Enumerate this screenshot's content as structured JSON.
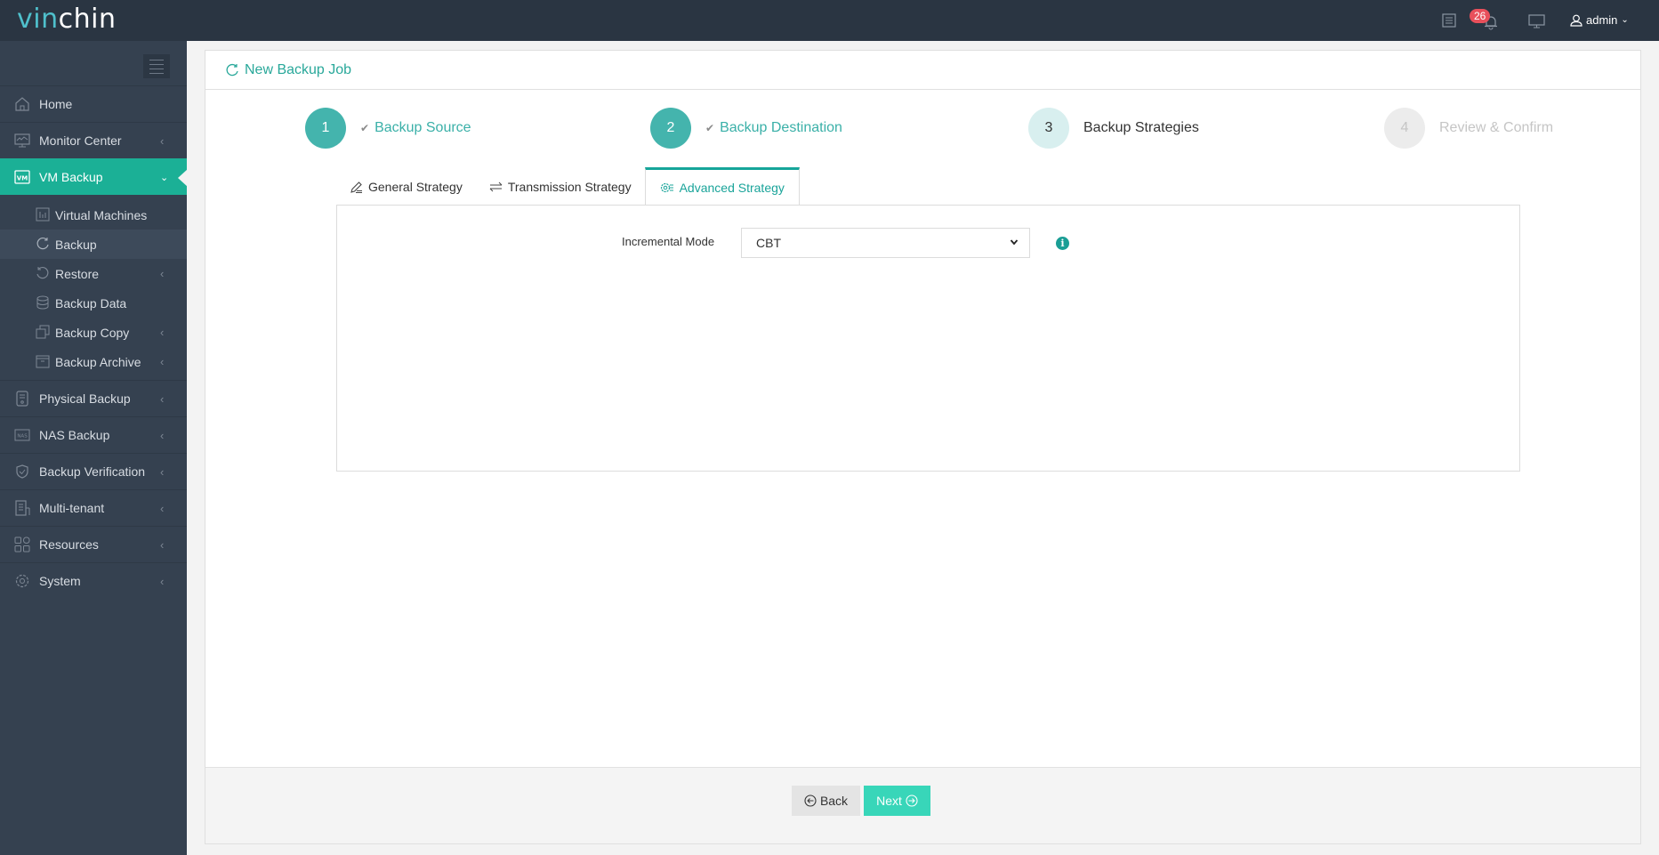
{
  "brand": {
    "logo_part1": "vin",
    "logo_part2": "chin"
  },
  "topbar": {
    "icons": [
      "task-list-icon",
      "bell-icon",
      "monitor-icon",
      "user-icon"
    ],
    "notification_count": "26",
    "user": "admin"
  },
  "sidebar": {
    "items": [
      {
        "label": "Home",
        "icon": "home-icon",
        "has_submenu": false
      },
      {
        "label": "Monitor Center",
        "icon": "monitor-chart-icon",
        "has_submenu": true
      },
      {
        "label": "VM Backup",
        "icon": "vm-icon",
        "has_submenu": true,
        "expanded": true,
        "active": true
      },
      {
        "label": "Physical Backup",
        "icon": "physical-server-icon",
        "has_submenu": true
      },
      {
        "label": "NAS Backup",
        "icon": "nas-icon",
        "has_submenu": true
      },
      {
        "label": "Backup Verification",
        "icon": "shield-check-icon",
        "has_submenu": true
      },
      {
        "label": "Multi-tenant",
        "icon": "building-icon",
        "has_submenu": true
      },
      {
        "label": "Resources",
        "icon": "grid-icon",
        "has_submenu": true
      },
      {
        "label": "System",
        "icon": "gear-icon",
        "has_submenu": true
      }
    ],
    "vm_backup_submenu": [
      {
        "label": "Virtual Machines",
        "icon": "bar-chart-icon",
        "has_submenu": false
      },
      {
        "label": "Backup",
        "icon": "refresh-icon",
        "has_submenu": false,
        "active": true
      },
      {
        "label": "Restore",
        "icon": "undo-icon",
        "has_submenu": true
      },
      {
        "label": "Backup Data",
        "icon": "database-icon",
        "has_submenu": false
      },
      {
        "label": "Backup Copy",
        "icon": "copy-icon",
        "has_submenu": true
      },
      {
        "label": "Backup Archive",
        "icon": "archive-icon",
        "has_submenu": true
      }
    ]
  },
  "page": {
    "title": "New Backup Job",
    "steps": [
      {
        "number": "1",
        "label": "Backup Source",
        "state": "done"
      },
      {
        "number": "2",
        "label": "Backup Destination",
        "state": "done"
      },
      {
        "number": "3",
        "label": "Backup Strategies",
        "state": "current"
      },
      {
        "number": "4",
        "label": "Review & Confirm",
        "state": "pending"
      }
    ],
    "tabs": [
      {
        "label": "General Strategy",
        "icon": "pencil-icon",
        "active": false
      },
      {
        "label": "Transmission Strategy",
        "icon": "transfer-icon",
        "active": false
      },
      {
        "label": "Advanced Strategy",
        "icon": "advanced-settings-icon",
        "active": true
      }
    ],
    "form": {
      "incremental_mode_label": "Incremental Mode",
      "incremental_mode_value": "CBT"
    },
    "buttons": {
      "back": "Back",
      "next": "Next"
    }
  },
  "colors": {
    "accent": "#1bb096",
    "step_done": "#44b4ad",
    "next_button": "#38d6b9",
    "header_bg": "#2a3542",
    "sidebar_bg": "#354150",
    "badge": "#e8505b"
  }
}
